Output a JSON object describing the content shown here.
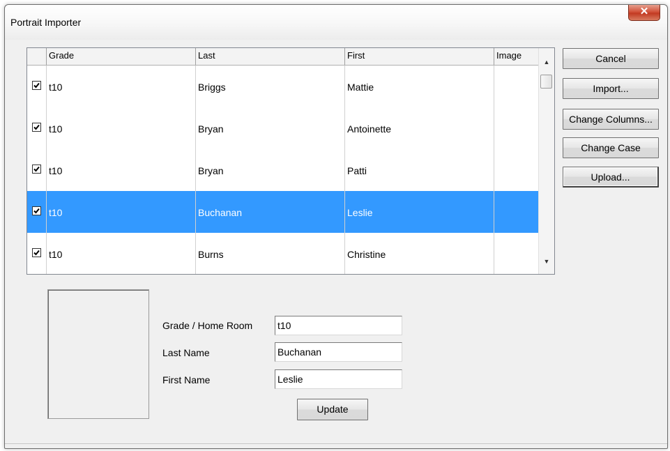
{
  "window": {
    "title": "Portrait Importer",
    "close_glyph": "✕"
  },
  "grid": {
    "columns": [
      "",
      "Grade",
      "Last",
      "First",
      "Image"
    ],
    "rows": [
      {
        "checked": true,
        "grade": "t10",
        "last": "Briggs",
        "first": "Mattie",
        "image": ""
      },
      {
        "checked": true,
        "grade": "t10",
        "last": "Bryan",
        "first": "Antoinette",
        "image": ""
      },
      {
        "checked": true,
        "grade": "t10",
        "last": "Bryan",
        "first": "Patti",
        "image": ""
      },
      {
        "checked": true,
        "grade": "t10",
        "last": "Buchanan",
        "first": "Leslie",
        "image": "",
        "selected": true
      },
      {
        "checked": true,
        "grade": "t10",
        "last": "Burns",
        "first": "Christine",
        "image": ""
      }
    ],
    "scroll_up_glyph": "▲",
    "scroll_down_glyph": "▼"
  },
  "buttons": {
    "cancel": "Cancel",
    "import": "Import...",
    "change_columns": "Change Columns...",
    "change_case": "Change Case",
    "upload": "Upload...",
    "update": "Update"
  },
  "form": {
    "grade_label": "Grade / Home Room",
    "grade_value": "t10",
    "last_label": "Last Name",
    "last_value": "Buchanan",
    "first_label": "First Name",
    "first_value": "Leslie"
  },
  "colors": {
    "selection": "#3399ff",
    "close_button": "#c23a22"
  }
}
